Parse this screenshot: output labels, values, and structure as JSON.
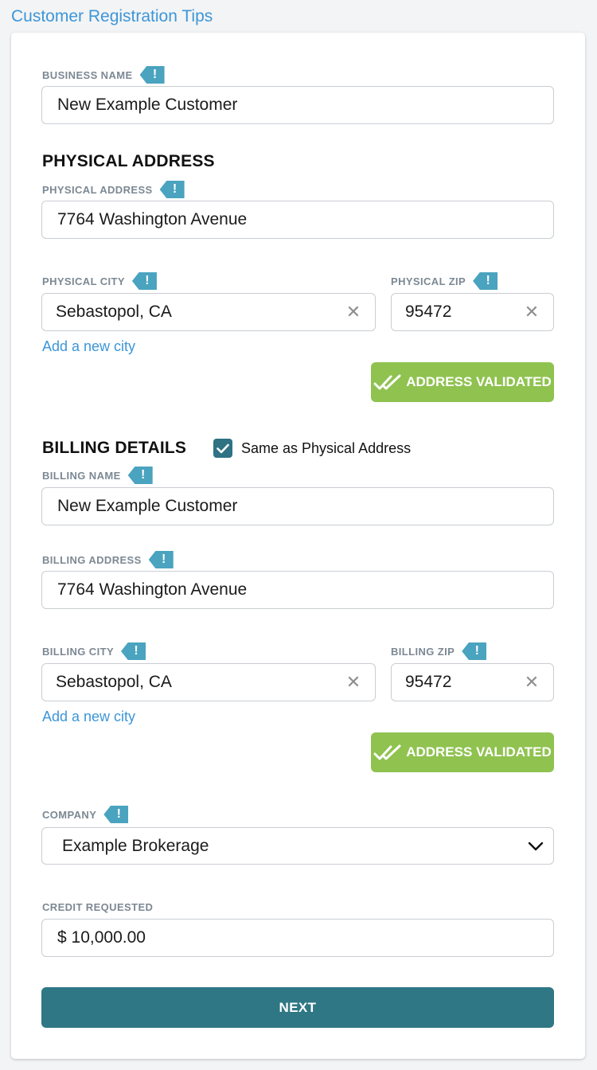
{
  "header": {
    "tips_link": "Customer Registration Tips"
  },
  "business": {
    "label": "BUSINESS NAME",
    "value": "New Example Customer"
  },
  "physical": {
    "section_title": "PHYSICAL ADDRESS",
    "address_label": "PHYSICAL ADDRESS",
    "address_value": "7764 Washington Avenue",
    "city_label": "PHYSICAL CITY",
    "city_value": "Sebastopol, CA",
    "zip_label": "PHYSICAL ZIP",
    "zip_value": "95472",
    "add_city": "Add a new city",
    "validated": "ADDRESS VALIDATED"
  },
  "billing": {
    "section_title": "BILLING DETAILS",
    "same_as_physical": "Same as Physical Address",
    "same_as_physical_checked": true,
    "name_label": "BILLING NAME",
    "name_value": "New Example Customer",
    "address_label": "BILLING ADDRESS",
    "address_value": "7764 Washington Avenue",
    "city_label": "BILLING CITY",
    "city_value": "Sebastopol, CA",
    "zip_label": "BILLING ZIP",
    "zip_value": "95472",
    "add_city": "Add a new city",
    "validated": "ADDRESS VALIDATED"
  },
  "company": {
    "label": "COMPANY",
    "selected": "Example Brokerage"
  },
  "credit": {
    "label": "CREDIT REQUESTED",
    "value": "$ 10,000.00"
  },
  "actions": {
    "next": "NEXT"
  },
  "icons": {
    "tip": "exclamation-tag-icon",
    "clear": "close-icon",
    "validated": "double-check-icon",
    "checkbox": "check-icon",
    "select": "chevron-down-icon"
  },
  "colors": {
    "link": "#3d96d8",
    "tip_flag": "#4aa3bf",
    "validated": "#8fc24f",
    "primary": "#2f7785",
    "checkbox": "#2e7283"
  },
  "tip_symbol": "!",
  "clear_symbol": "✕"
}
